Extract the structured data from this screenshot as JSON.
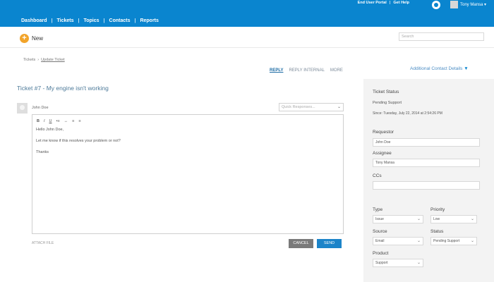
{
  "header": {
    "top_links": [
      "End User Portal",
      "Get Help"
    ],
    "user_name": "Tony Mansa",
    "nav": [
      "Dashboard",
      "Tickets",
      "Topics",
      "Contacts",
      "Reports"
    ]
  },
  "toolbar": {
    "new_label": "New",
    "search_placeholder": "Search"
  },
  "breadcrumb": {
    "root": "Tickets",
    "current": "Update Ticket"
  },
  "actions": {
    "reply": "REPLY",
    "reply_internal": "REPLY INTERNAL",
    "more": "MORE",
    "additional": "Additional Contact Details"
  },
  "ticket": {
    "title": "Ticket #7 - My engine isn't working"
  },
  "composer": {
    "requester_name": "John Doe",
    "quick_placeholder": "Quick Responses...",
    "format_buttons": [
      "B",
      "I",
      "U",
      "•≡",
      "↔",
      "≡",
      "≡"
    ],
    "body_lines": [
      "Hello John Doe,",
      "Let me know if this resolves your problem or not?",
      "Thanks"
    ],
    "attach_label": "ATTACH FILE",
    "cancel_label": "CANCEL",
    "send_label": "SEND"
  },
  "sidebar": {
    "status_label": "Ticket Status",
    "status_value": "Pending Support",
    "since_text": "Since: Tuesday, July 22, 2014 at 2:54:26 PM",
    "requestor_label": "Requestor",
    "requestor_value": "John Doe",
    "assignee_label": "Assignee",
    "assignee_value": "Tony Mansa",
    "ccs_label": "CCs",
    "ccs_value": "",
    "type_label": "Type",
    "type_value": "Issue",
    "priority_label": "Priority",
    "priority_value": "Low",
    "source_label": "Source",
    "source_value": "Email",
    "status_sel_label": "Status",
    "status_sel_value": "Pending Support",
    "product_label": "Product",
    "product_value": "Support"
  },
  "colors": {
    "header_blue": "#0a85cf",
    "new_orange": "#f2a42a",
    "send_blue": "#1c84c9",
    "cancel_grey": "#7a7a7a"
  }
}
